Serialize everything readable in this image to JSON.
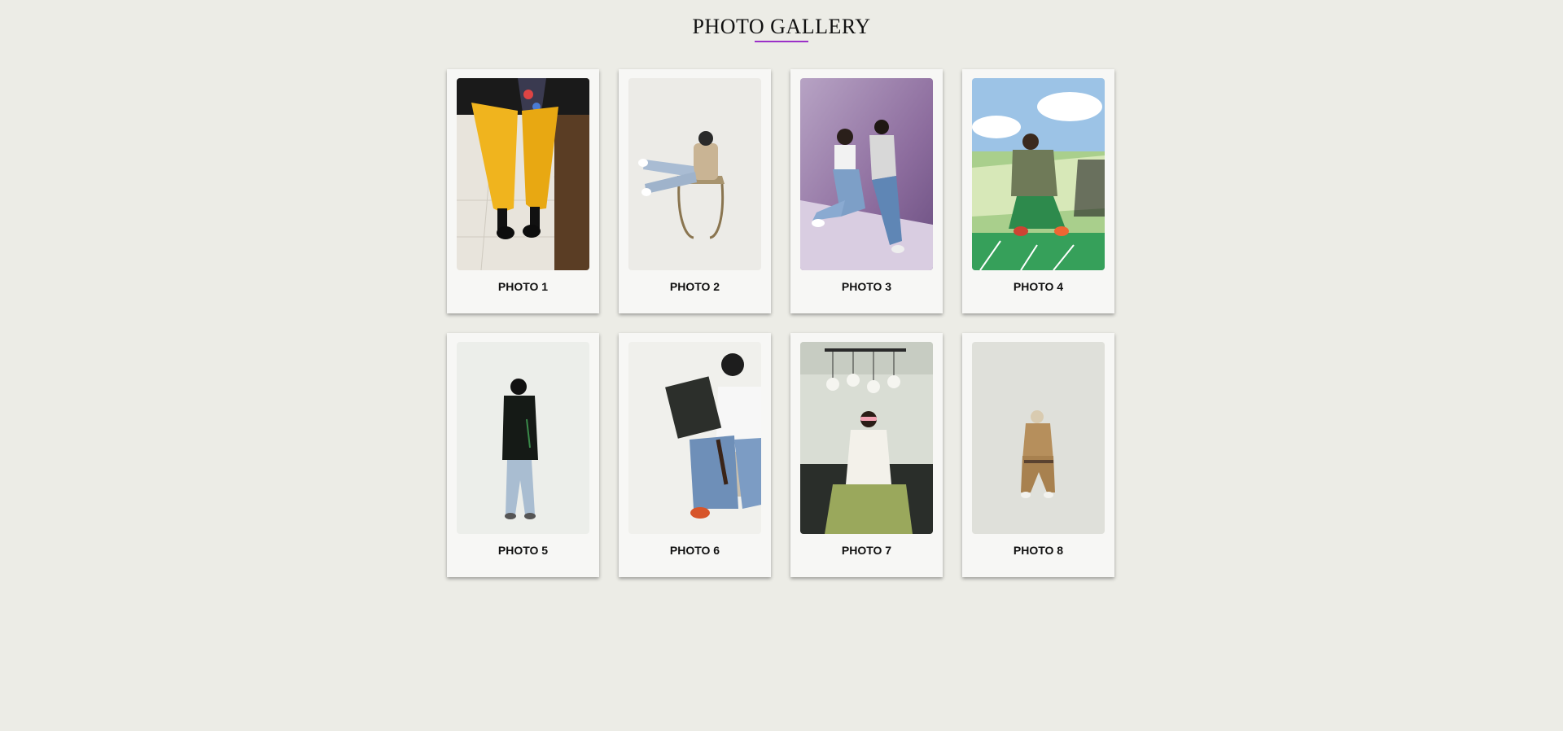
{
  "header": {
    "title": "PHOTO GALLERY",
    "accent_color": "#9b30c8"
  },
  "gallery": {
    "items": [
      {
        "caption": "PHOTO 1",
        "subject": "yellow-corduroy-pants-photo"
      },
      {
        "caption": "PHOTO 2",
        "subject": "seated-man-chair-photo"
      },
      {
        "caption": "PHOTO 3",
        "subject": "couple-purple-backdrop-photo"
      },
      {
        "caption": "PHOTO 4",
        "subject": "man-graffiti-wall-photo"
      },
      {
        "caption": "PHOTO 5",
        "subject": "man-back-view-photo"
      },
      {
        "caption": "PHOTO 6",
        "subject": "man-shopping-bag-photo"
      },
      {
        "caption": "PHOTO 7",
        "subject": "woman-lamps-photo"
      },
      {
        "caption": "PHOTO 8",
        "subject": "seated-tan-suit-photo"
      }
    ]
  }
}
